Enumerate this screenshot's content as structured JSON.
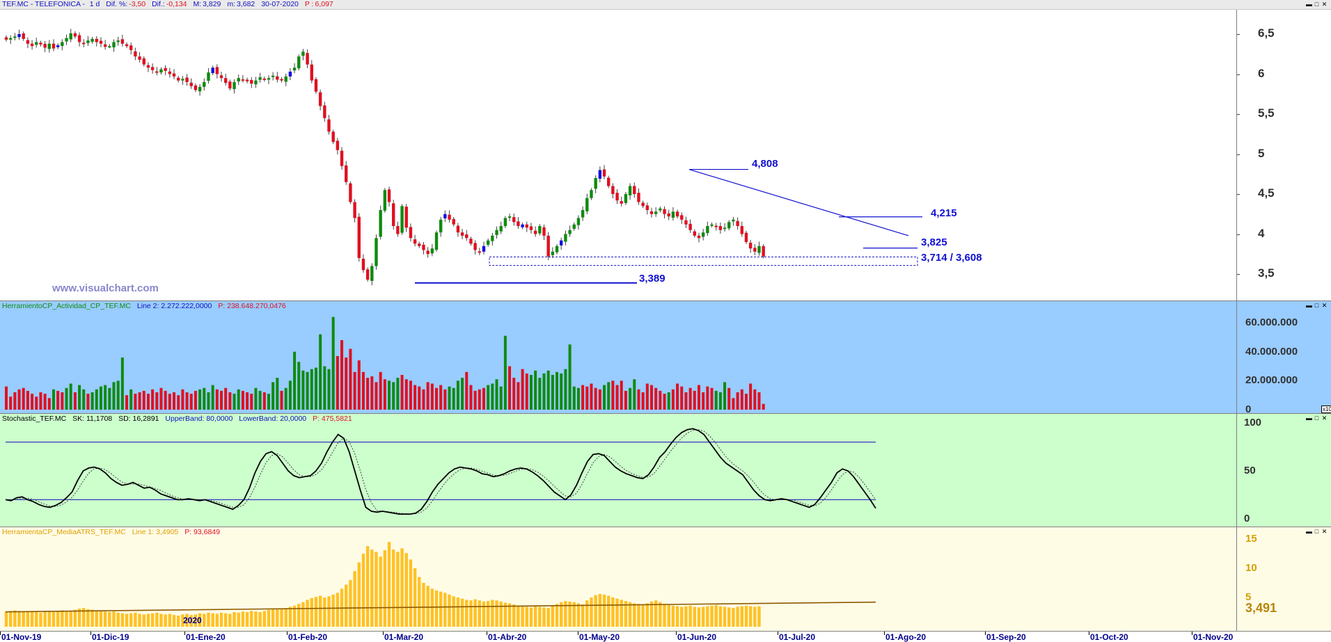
{
  "header": {
    "symbol": "TEF.MC - TELEFONICA -",
    "period": "1 d",
    "dif_pct_label": "Dif. %:",
    "dif_pct": "-3,50",
    "dif_label": "Dif.:",
    "dif": "-0,134",
    "max_label": "M:",
    "max": "3,829",
    "min_label": "m:",
    "min": "3,682",
    "date": "30-07-2020",
    "p_label": "P :",
    "p": "6,097"
  },
  "watermark": "www.visualchart.com",
  "annotations": {
    "top": "4,808",
    "resistance": "4,215",
    "last": "3,825",
    "support_zone": "3,714 / 3,608",
    "low": "3,389"
  },
  "volume_panel": {
    "name": "HerramientoCP_Actividad_CP_TEF.MC",
    "line_label": "Line 2: 2.272.222,0000",
    "p_label": "P: 238.648.270,0476",
    "corner": "x10"
  },
  "stoch_panel": {
    "name": "Stochastic_TEF.MC",
    "sk": "SK: 11,1708",
    "sd": "SD: 16,2891",
    "upper": "UpperBand: 80,0000",
    "lower": "LowerBand: 20,0000",
    "p_label": "P: 475,5821"
  },
  "atr_panel": {
    "name": "HerramientaCP_MediaATRS_TEF.MC",
    "line_label": "Line 1: 3,4905",
    "p_label": "P: 93,6849",
    "year_marker": "2020",
    "last_value": "3,491"
  },
  "colors": {
    "up": "#108a10",
    "down": "#e01020",
    "blue_candle": "#1010e0",
    "volume_bg": "#99ccff",
    "stoch_bg": "#ccffcc",
    "atr_bg": "#fffce6",
    "atr_bar": "#ffc125"
  },
  "chart_data": [
    {
      "type": "candlestick",
      "title": "TEF.MC - TELEFONICA - 1 d",
      "x_dates": [
        "01-Nov-19",
        "01-Dic-19",
        "01-Ene-20",
        "01-Feb-20",
        "01-Mar-20",
        "01-Abr-20",
        "01-May-20",
        "01-Jun-20",
        "01-Jul-20",
        "01-Ago-20",
        "01-Sep-20",
        "01-Oct-20",
        "01-Nov-20"
      ],
      "y_ticks": [
        "6,5",
        "6",
        "5,5",
        "5",
        "4,5",
        "4",
        "3,5"
      ],
      "ylim": [
        3.2,
        6.8
      ],
      "close_series": [
        6.43,
        6.45,
        6.47,
        6.5,
        6.44,
        6.38,
        6.35,
        6.4,
        6.37,
        6.33,
        6.38,
        6.32,
        6.36,
        6.4,
        6.45,
        6.51,
        6.47,
        6.4,
        6.38,
        6.42,
        6.44,
        6.4,
        6.38,
        6.34,
        6.35,
        6.4,
        6.42,
        6.38,
        6.35,
        6.3,
        6.22,
        6.18,
        6.12,
        6.08,
        6.05,
        6.02,
        6.06,
        6.04,
        6.0,
        5.97,
        5.92,
        5.94,
        5.9,
        5.85,
        5.8,
        5.84,
        5.9,
        6.02,
        6.08,
        6.0,
        5.95,
        5.89,
        5.82,
        5.9,
        5.95,
        5.93,
        5.91,
        5.88,
        5.92,
        5.96,
        5.93,
        5.95,
        5.98,
        5.93,
        5.92,
        5.97,
        6.03,
        6.08,
        6.22,
        6.28,
        6.12,
        5.92,
        5.78,
        5.6,
        5.45,
        5.28,
        5.15,
        5.05,
        4.85,
        4.65,
        4.4,
        4.2,
        3.7,
        3.55,
        3.43,
        3.6,
        3.95,
        4.3,
        4.55,
        4.4,
        4.1,
        4.0,
        4.35,
        4.08,
        3.95,
        3.88,
        3.85,
        3.8,
        3.75,
        3.82,
        4.02,
        4.18,
        4.25,
        4.18,
        4.12,
        4.02,
        3.98,
        3.95,
        3.88,
        3.8,
        3.78,
        3.85,
        3.92,
        3.98,
        4.05,
        4.1,
        4.2,
        4.22,
        4.15,
        4.1,
        4.12,
        4.08,
        4.05,
        4.0,
        4.1,
        3.98,
        3.72,
        3.78,
        3.85,
        3.92,
        4.0,
        4.05,
        4.12,
        4.2,
        4.3,
        4.45,
        4.55,
        4.7,
        4.8,
        4.72,
        4.6,
        4.5,
        4.42,
        4.38,
        4.5,
        4.6,
        4.5,
        4.4,
        4.35,
        4.3,
        4.25,
        4.28,
        4.32,
        4.25,
        4.22,
        4.28,
        4.22,
        4.18,
        4.12,
        4.05,
        3.98,
        3.95,
        4.02,
        4.1,
        4.12,
        4.1,
        4.05,
        4.08,
        4.15,
        4.18,
        4.1,
        4.0,
        3.9,
        3.82,
        3.78,
        3.85,
        3.72
      ],
      "levels": {
        "top": 4.808,
        "resistance": 4.215,
        "last": 3.825,
        "support_zone": [
          3.608,
          3.714
        ],
        "low": 3.389
      }
    },
    {
      "type": "bar",
      "title": "HerramientoCP_Actividad_CP_TEF.MC",
      "y_ticks": [
        "60.000.000",
        "40.000.000",
        "20.000.000",
        "0"
      ],
      "ylim": [
        0,
        65000000
      ],
      "values_millions": [
        16,
        9,
        12,
        14,
        15,
        13,
        11,
        9,
        12,
        11,
        8,
        14,
        13,
        12,
        15,
        18,
        12,
        17,
        14,
        11,
        12,
        14,
        16,
        17,
        15,
        19,
        20,
        36,
        10,
        14,
        11,
        12,
        13,
        11,
        14,
        12,
        15,
        13,
        11,
        12,
        10,
        14,
        12,
        11,
        13,
        14,
        15,
        12,
        17,
        14,
        13,
        15,
        12,
        11,
        14,
        13,
        12,
        11,
        15,
        13,
        12,
        11,
        19,
        22,
        13,
        15,
        20,
        40,
        33,
        27,
        26,
        28,
        29,
        52,
        30,
        28,
        64,
        37,
        48,
        36,
        42,
        26,
        34,
        26,
        22,
        23,
        19,
        26,
        21,
        20,
        19,
        22,
        24,
        21,
        20,
        17,
        16,
        14,
        19,
        18,
        15,
        17,
        14,
        16,
        15,
        20,
        22,
        26,
        17,
        13,
        14,
        15,
        17,
        18,
        21,
        16,
        51,
        30,
        22,
        19,
        28,
        25,
        24,
        27,
        22,
        25,
        27,
        24,
        26,
        25,
        28,
        45,
        16,
        15,
        17,
        16,
        18,
        15,
        14,
        17,
        19,
        20,
        17,
        20,
        13,
        15,
        21,
        14,
        12,
        18,
        17,
        15,
        13,
        11,
        12,
        14,
        18,
        16,
        12,
        15,
        13,
        17,
        12,
        16,
        15,
        13,
        12,
        19,
        15,
        8,
        12,
        14,
        11,
        18,
        14,
        12,
        4
      ],
      "colors": [
        "d",
        "d",
        "d",
        "d",
        "d",
        "d",
        "d",
        "d",
        "d",
        "d",
        "d",
        "u",
        "d",
        "d",
        "u",
        "u",
        "d",
        "u",
        "u",
        "d",
        "u",
        "u",
        "u",
        "u",
        "u",
        "u",
        "u",
        "u",
        "d",
        "u",
        "d",
        "d",
        "d",
        "d",
        "d",
        "d",
        "d",
        "d",
        "d",
        "d",
        "d",
        "d",
        "d",
        "d",
        "d",
        "u",
        "u",
        "u",
        "u",
        "d",
        "d",
        "d",
        "d",
        "u",
        "u",
        "d",
        "d",
        "d",
        "u",
        "u",
        "d",
        "u",
        "u",
        "u",
        "d",
        "u",
        "u",
        "u",
        "u",
        "u",
        "u",
        "u",
        "u",
        "u",
        "u",
        "u",
        "u",
        "d",
        "d",
        "d",
        "d",
        "d",
        "d",
        "d",
        "d",
        "d",
        "d",
        "d",
        "d",
        "u",
        "u",
        "u",
        "d",
        "d",
        "d",
        "d",
        "d",
        "d",
        "d",
        "d",
        "d",
        "d",
        "d",
        "u",
        "u",
        "u",
        "u",
        "d",
        "d",
        "d",
        "d",
        "d",
        "u",
        "u",
        "u",
        "u",
        "u",
        "d",
        "d",
        "d",
        "d",
        "d",
        "u",
        "u",
        "u",
        "u",
        "u",
        "u",
        "u",
        "u",
        "u",
        "u",
        "u",
        "u",
        "d",
        "d",
        "d",
        "d",
        "d",
        "u",
        "u",
        "d",
        "d",
        "d",
        "d",
        "u",
        "u",
        "d",
        "d",
        "d",
        "d",
        "d",
        "d",
        "d",
        "u",
        "d",
        "d",
        "d",
        "d",
        "d",
        "d",
        "d",
        "d",
        "d",
        "d",
        "u",
        "u",
        "u",
        "d",
        "d",
        "d",
        "d",
        "d",
        "d",
        "d",
        "d",
        "d",
        "d",
        "d",
        "d",
        "d",
        "d"
      ]
    },
    {
      "type": "line",
      "title": "Stochastic_TEF.MC",
      "y_ticks": [
        "100",
        "50",
        "0"
      ],
      "ylim": [
        0,
        100
      ],
      "bands": [
        80,
        20
      ],
      "sk": [
        20,
        19,
        22,
        23,
        20,
        18,
        15,
        13,
        12,
        14,
        17,
        22,
        28,
        40,
        50,
        53,
        54,
        52,
        48,
        42,
        38,
        35,
        36,
        38,
        35,
        32,
        33,
        30,
        26,
        24,
        22,
        20,
        20,
        21,
        20,
        19,
        20,
        18,
        16,
        14,
        12,
        10,
        14,
        20,
        32,
        48,
        60,
        68,
        70,
        66,
        58,
        50,
        45,
        43,
        44,
        45,
        50,
        58,
        70,
        80,
        88,
        84,
        70,
        50,
        30,
        12,
        8,
        7,
        8,
        7,
        6,
        5,
        5,
        5,
        6,
        10,
        18,
        28,
        36,
        42,
        48,
        52,
        54,
        53,
        52,
        50,
        47,
        46,
        44,
        45,
        47,
        50,
        52,
        53,
        52,
        49,
        45,
        40,
        34,
        28,
        24,
        20,
        25,
        35,
        48,
        60,
        67,
        68,
        66,
        60,
        54,
        50,
        47,
        45,
        43,
        42,
        46,
        54,
        64,
        70,
        78,
        85,
        90,
        93,
        94,
        92,
        88,
        80,
        72,
        64,
        58,
        54,
        50,
        46,
        38,
        30,
        24,
        20,
        19,
        20,
        21,
        20,
        18,
        16,
        14,
        12,
        15,
        22,
        30,
        38,
        48,
        52,
        50,
        44,
        36,
        28,
        20,
        11
      ]
    },
    {
      "type": "bar",
      "title": "HerramientaCP_MediaATRS_TEF.MC",
      "y_ticks": [
        "15",
        "10",
        "5"
      ],
      "ylim": [
        0,
        15
      ],
      "line_value": 3.4905,
      "values": [
        2.6,
        2.7,
        2.8,
        2.7,
        2.6,
        2.5,
        2.6,
        2.5,
        2.4,
        2.6,
        2.7,
        2.5,
        2.6,
        2.8,
        2.7,
        2.6,
        2.9,
        3.1,
        3.2,
        3.0,
        2.9,
        2.8,
        2.7,
        2.6,
        2.5,
        2.6,
        2.4,
        2.3,
        2.2,
        2.3,
        2.4,
        2.2,
        2.1,
        2.2,
        2.3,
        2.4,
        2.2,
        2.1,
        2.2,
        2.0,
        1.9,
        2.1,
        2.2,
        2.0,
        2.1,
        2.3,
        2.2,
        2.4,
        2.3,
        2.2,
        2.4,
        2.3,
        2.2,
        2.5,
        2.4,
        2.6,
        2.5,
        2.7,
        2.6,
        2.5,
        2.7,
        2.9,
        3.0,
        3.1,
        3.0,
        3.2,
        3.4,
        3.6,
        3.9,
        4.2,
        4.6,
        4.9,
        5.1,
        5.3,
        5.0,
        5.2,
        5.5,
        5.8,
        6.5,
        7.2,
        8.0,
        9.5,
        11.0,
        12.5,
        13.8,
        13.2,
        12.8,
        12.0,
        13.1,
        14.5,
        13.2,
        12.8,
        13.4,
        12.6,
        11.5,
        10.0,
        8.5,
        7.5,
        7.0,
        6.5,
        6.2,
        6.0,
        5.8,
        5.5,
        5.2,
        5.0,
        4.8,
        4.6,
        4.5,
        4.7,
        4.5,
        4.3,
        4.4,
        4.6,
        4.5,
        4.3,
        4.1,
        4.0,
        3.8,
        3.6,
        3.5,
        3.4,
        3.3,
        3.5,
        3.4,
        3.3,
        3.2,
        3.6,
        3.9,
        4.2,
        4.4,
        4.3,
        4.2,
        4.0,
        3.8,
        4.5,
        5.0,
        5.4,
        5.6,
        5.5,
        5.3,
        5.0,
        4.8,
        4.6,
        4.4,
        4.2,
        4.0,
        3.9,
        3.8,
        4.0,
        4.3,
        4.5,
        4.2,
        3.9,
        3.7,
        3.6,
        3.5,
        3.4,
        3.5,
        3.6,
        3.4,
        3.3,
        3.4,
        3.5,
        3.6,
        3.7,
        3.5,
        3.4,
        3.3,
        3.2,
        3.4,
        3.5,
        3.6,
        3.5,
        3.4,
        3.5
      ]
    }
  ]
}
